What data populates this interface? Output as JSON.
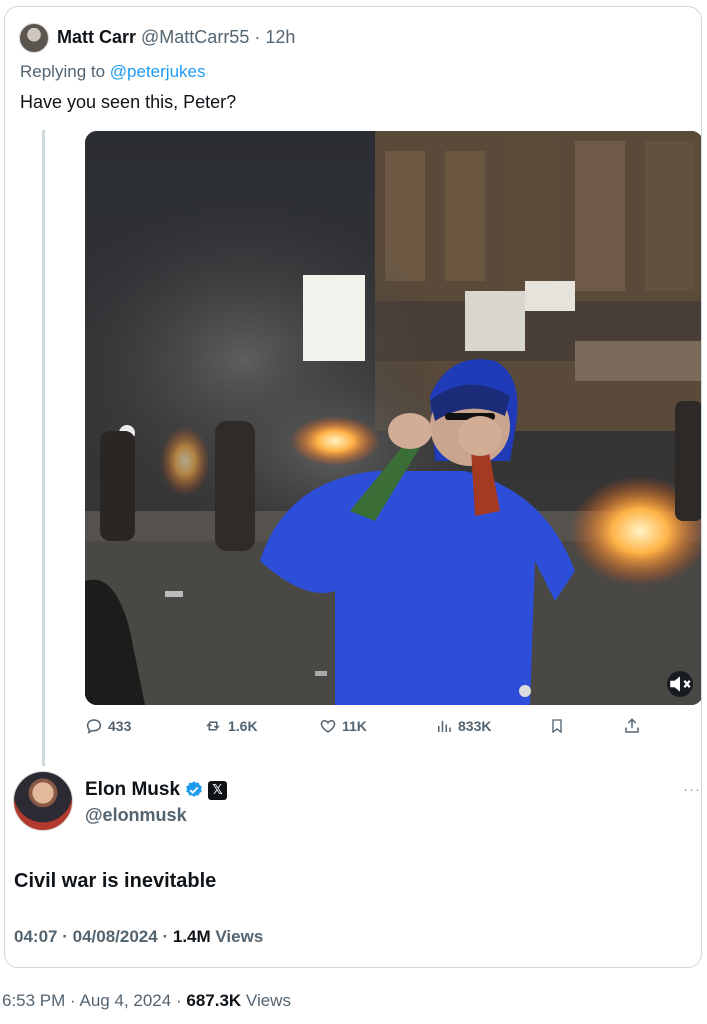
{
  "reply_tweet": {
    "author_name": "Matt Carr",
    "author_handle": "@MattCarr55",
    "separator": "·",
    "age": "12h",
    "replying_prefix": "Replying to ",
    "replying_to": "@peterjukes",
    "text": "Have you seen this, Peter?",
    "media": {
      "kind": "video",
      "muted": true
    },
    "stats": {
      "replies": "433",
      "reposts": "1.6K",
      "likes": "11K",
      "views": "833K"
    }
  },
  "quoted_tweet": {
    "author_name": "Elon Musk",
    "verified": true,
    "affiliate_badge": "𝕏",
    "author_handle": "@elonmusk",
    "more_menu": "···",
    "text": "Civil war is inevitable",
    "time": "04:07",
    "separator": "·",
    "date": "04/08/2024",
    "views_count": "1.4M",
    "views_label": "Views"
  },
  "footer": {
    "time": "6:53 PM",
    "separator": "·",
    "date": "Aug 4, 2024",
    "views_count": "687.3K",
    "views_label": "Views"
  },
  "colors": {
    "accent": "#1d9bf0",
    "text_primary": "#0f1419",
    "text_secondary": "#536471",
    "border": "#cfd9de"
  },
  "icons": [
    "reply-icon",
    "repost-icon",
    "like-icon",
    "views-icon",
    "bookmark-icon",
    "share-icon",
    "mute-icon",
    "verified-icon"
  ]
}
